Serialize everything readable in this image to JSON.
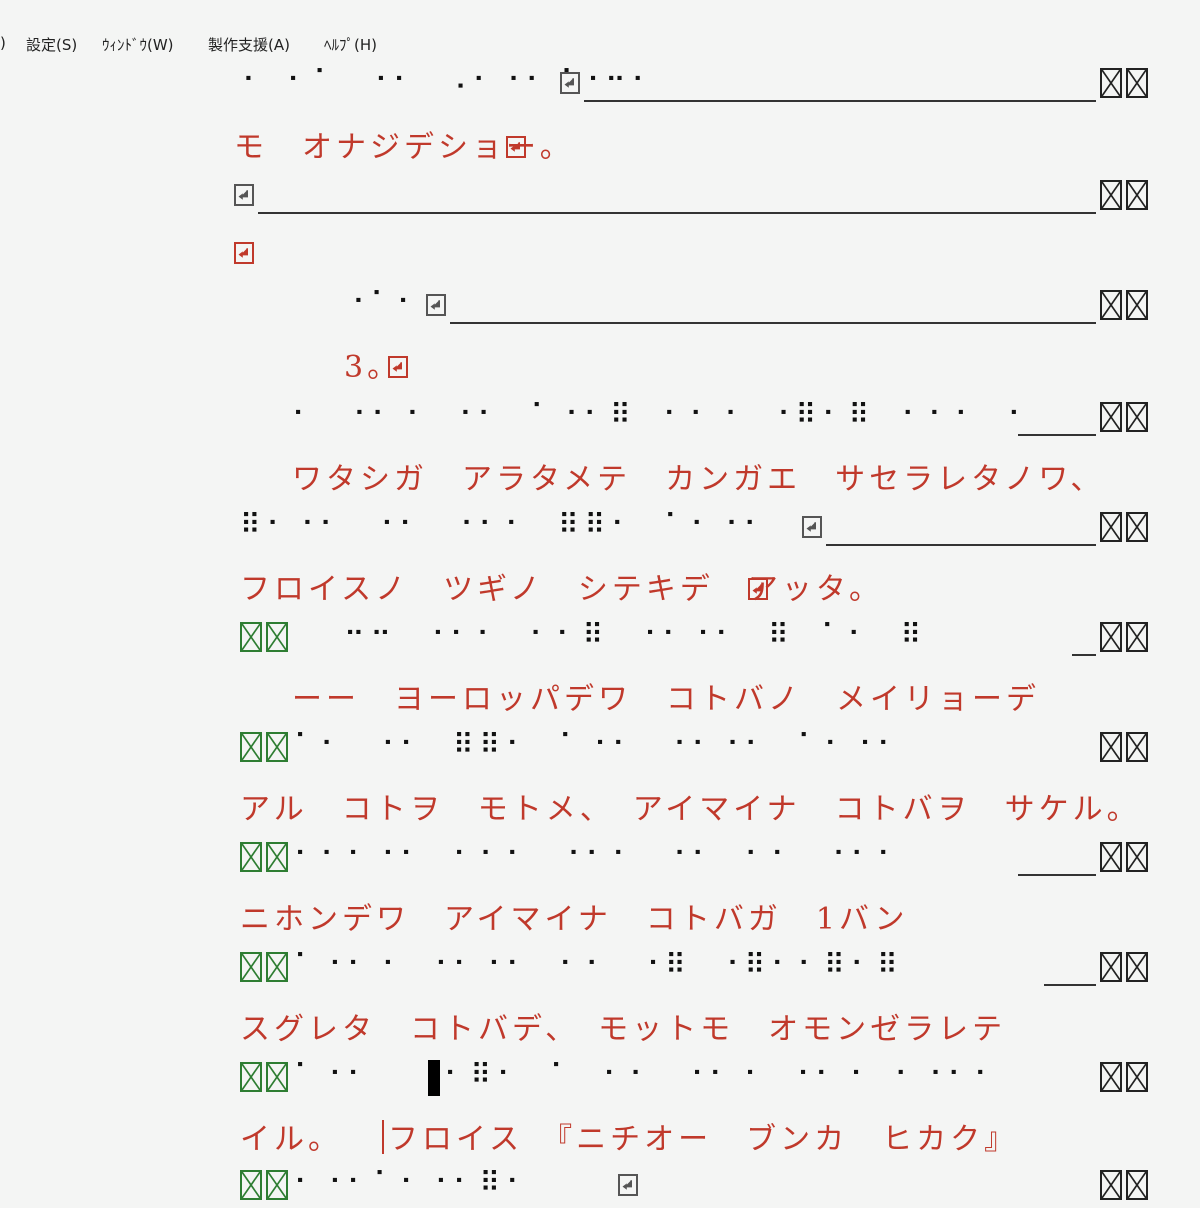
{
  "menu": {
    "items": [
      {
        "label": ")"
      },
      {
        "label": "設定(S)"
      },
      {
        "label": "ｳｨﾝﾄﾞｳ(W)"
      },
      {
        "label": "製作支援(A)"
      },
      {
        "label": "ﾍﾙﾌﾟ(H)"
      }
    ]
  },
  "lines": {
    "b1": "⠐⠀⠂⠁⠀⠐⠂⠀⠠⠂⠐⠂⠈⠐⠒⠂",
    "k1": "モ　オナジデショー。",
    "b3": "⠐⠁⠂",
    "k3": "3。",
    "b4": "⠂⠀⠐⠂⠐⠀⠐⠂⠀⠁⠐⠂⠿⠀⠂⠂⠐⠀⠐⠿⠂⠿⠀⠂⠂⠂⠀⠂⠀",
    "k4": "ワタシガ　アラタメテ　カンガエ　サセラレタノワ、",
    "b5": "⠿⠂⠐⠂⠀⠐⠂⠀⠐⠂⠂⠀⠿⠿⠂⠀⠁⠂⠐⠂",
    "k5": "フロイスノ　ツギノ　シテキデ　アッタ。",
    "b6": "⠒⠒⠀⠐⠂⠂⠀⠂⠂⠿⠀⠐⠂⠐⠂⠀⠿⠀⠁⠂⠀⠿",
    "k6": "ーー　ヨーロッパデワ　コトバノ　メイリョーデ",
    "b7": "⠁⠂⠀⠐⠂⠀⠿⠿⠂⠀⠁⠐⠂⠀⠐⠂⠐⠂⠀⠁⠂⠐⠂",
    "k7": "アル　コトヲ　モトメ、　アイマイナ　コトバヲ　サケル。",
    "b8": "⠂⠂⠂⠐⠂⠀⠂⠂⠂⠀⠐⠂⠂⠀⠐⠂⠀⠂⠂⠀⠐⠂⠂",
    "k8": "ニホンデワ　アイマイナ　コトバガ　1バン",
    "b9": "⠁⠐⠂⠐⠀⠐⠂⠐⠂⠀⠂⠂⠀⠐⠿⠀⠐⠿⠂⠂⠿⠂⠿",
    "k9": "スグレタ　コトバデ、　モットモ　オモンゼラレテ",
    "b10a": "⠁⠐⠂",
    "b10b": "⠂⠿⠂⠀⠁⠀⠂⠂⠀⠐⠂⠐⠀⠐⠂⠐⠀⠂⠐⠂⠂",
    "k10a": "イル。",
    "k10b": "フロイス　『ニチオー　ブンカ　ヒカク』",
    "b11": "⠂⠐⠂⠁⠂⠐⠂⠿⠂"
  }
}
